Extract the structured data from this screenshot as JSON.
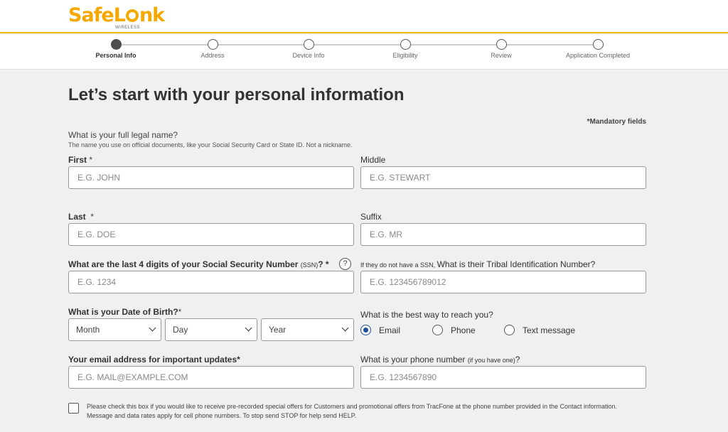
{
  "brand": {
    "name_part1": "Safe",
    "name_part2": "L",
    "name_part3": "nk",
    "subtitle": "WIRELESS"
  },
  "steps": [
    {
      "label": "Personal Info",
      "active": true
    },
    {
      "label": "Address",
      "active": false
    },
    {
      "label": "Device Info",
      "active": false
    },
    {
      "label": "Eligibility",
      "active": false
    },
    {
      "label": "Review",
      "active": false
    },
    {
      "label": "Application Completed",
      "active": false
    }
  ],
  "form": {
    "title": "Let’s start with your personal information",
    "mandatory_note": "*Mandatory fields",
    "name_question": "What is your full legal name?",
    "name_hint": "The name you use on official documents, like your Social Security Card or State ID. Not a nickname.",
    "first": {
      "label": "First",
      "req": "*",
      "placeholder": "E.G. JOHN",
      "value": ""
    },
    "middle": {
      "label": "Middle",
      "placeholder": "E.G. STEWART",
      "value": ""
    },
    "last": {
      "label": "Last",
      "req": "*",
      "placeholder": "E.G. DOE",
      "value": ""
    },
    "suffix": {
      "label": "Suffix",
      "placeholder": "E.G. MR",
      "value": ""
    },
    "ssn": {
      "label_main": "What are the last 4 digits of your Social Security Number ",
      "label_small": "(SSN)",
      "label_end": "? *",
      "help": "?",
      "placeholder": "E.G. 1234"
    },
    "tribal": {
      "label_small": "If they do not have a SSN, ",
      "label_main": "What is their Tribal Identification Number?",
      "placeholder": "E.G. 123456789012"
    },
    "dob": {
      "label": "What is your Date of Birth?",
      "req": "*",
      "month": "Month",
      "day": "Day",
      "year": "Year"
    },
    "contact": {
      "label": "What is the best way to reach you?",
      "options": [
        "Email",
        "Phone",
        "Text message"
      ],
      "selected": "Email"
    },
    "email": {
      "label": "Your email address for important updates*",
      "placeholder": "E.G. MAIL@EXAMPLE.COM"
    },
    "phone": {
      "label_main": "What is your phone number ",
      "label_small": "(if you have one)",
      "label_end": "?",
      "placeholder": "E.G. 1234567890"
    },
    "consent": "Please check this box if you would like to receive pre-recorded special offers for Customers and promotional offers from TracFone at the phone number provided in the Contact information. Message and data rates apply for cell phone numbers. To stop send STOP for help send HELP."
  },
  "colors": {
    "brand_yellow": "#f5a800",
    "radio_blue": "#1a4f9c"
  }
}
